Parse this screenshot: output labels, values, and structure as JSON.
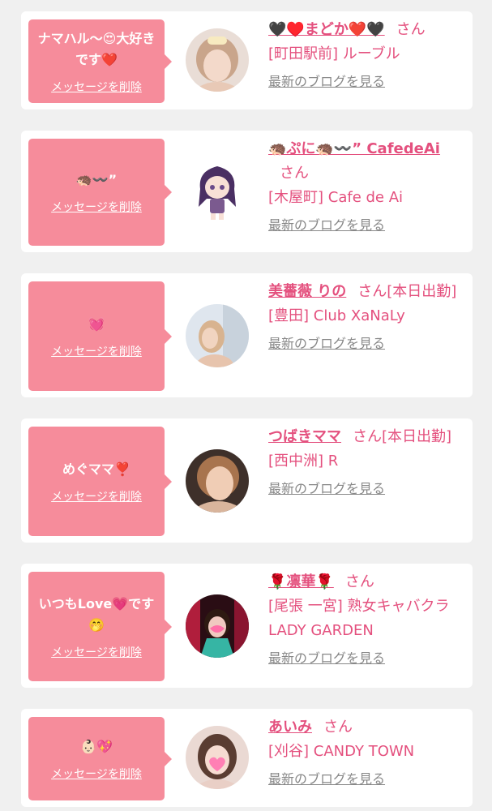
{
  "colors": {
    "bubble": "#f68c9b",
    "accent": "#e4507e",
    "link_gray": "#888888",
    "background": "#f0f0f0"
  },
  "cards": [
    {
      "message": "ナマハル〜😍大好きです❤️",
      "delete_label": "メッセージを削除",
      "name": "🖤♥️まどか❤️🖤",
      "suffix": "さん",
      "shop": "[町田駅前] ルーブル",
      "blog_label": "最新のブログを見る",
      "avatar_icon": "woman-portrait-avatar"
    },
    {
      "message": "🦔〰️”",
      "delete_label": "メッセージを削除",
      "name": "🦔ぷに🦔〰️” CafedeAi",
      "suffix": "さん",
      "shop": "[木屋町] Cafe de Ai",
      "blog_label": "最新のブログを見る",
      "avatar_icon": "anime-character-avatar"
    },
    {
      "message": "💓",
      "delete_label": "メッセージを削除",
      "name": "美薔薇 りの",
      "suffix": "さん[本日出勤]",
      "shop": "[豊田] Club XaNaLy",
      "blog_label": "最新のブログを見る",
      "avatar_icon": "woman-portrait-avatar"
    },
    {
      "message": "めぐママ❣️",
      "delete_label": "メッセージを削除",
      "name": "つばきママ",
      "suffix": "さん[本日出勤]",
      "shop": "[西中洲] R",
      "blog_label": "最新のブログを見る",
      "avatar_icon": "woman-portrait-avatar"
    },
    {
      "message": "いつもLove💗です🤭",
      "delete_label": "メッセージを削除",
      "name": "🌹凛華🌹",
      "suffix": "さん",
      "shop": "[尾張 一宮] 熟女キャバクラ LADY GARDEN",
      "blog_label": "最新のブログを見る",
      "avatar_icon": "woman-portrait-avatar"
    },
    {
      "message": "👶🏻💖",
      "delete_label": "メッセージを削除",
      "name": "あいみ",
      "suffix": "さん",
      "shop": "[刈谷] CANDY TOWN",
      "blog_label": "最新のブログを見る",
      "avatar_icon": "woman-portrait-avatar"
    }
  ]
}
